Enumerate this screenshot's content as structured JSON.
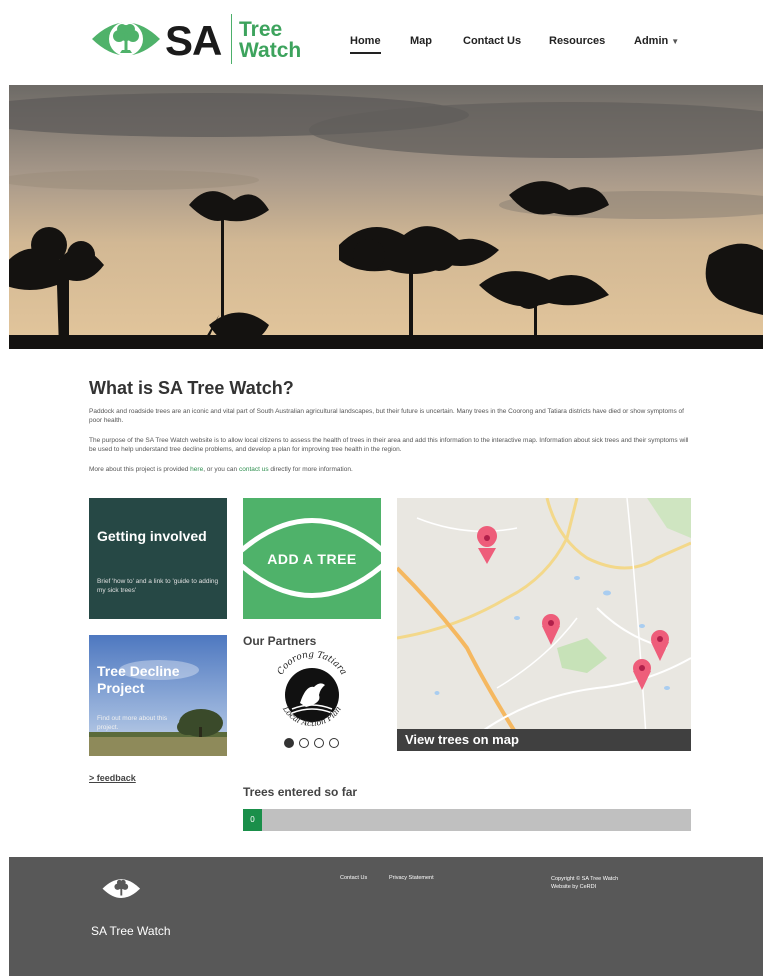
{
  "header": {
    "logo_sa": "SA",
    "logo_tree": "Tree",
    "logo_watch": "Watch"
  },
  "nav": {
    "home": "Home",
    "map": "Map",
    "contact": "Contact Us",
    "resources": "Resources",
    "admin": "Admin"
  },
  "intro": {
    "title": "What is SA Tree Watch?",
    "p1": "Paddock and roadside trees are an iconic and vital part of South Australian agricultural landscapes, but their future is uncertain. Many trees in the Coorong and Tatiara districts have died or show symptoms of poor health.",
    "p2": "The purpose of the SA Tree Watch website is to allow local citizens to assess the health of trees in their area and add this information to the interactive map. Information about sick trees and their symptoms will be used to help understand tree decline problems, and develop a plan for improving tree health in the region.",
    "p3_a": "More about this project is provided ",
    "p3_link1": "here",
    "p3_b": ", or you can ",
    "p3_link2": "contact us",
    "p3_c": " directly for more information."
  },
  "tiles": {
    "getting_title": "Getting involved",
    "getting_desc": "Brief 'how to' and a link to 'guide to adding my sick trees'",
    "add_tree": "ADD A TREE",
    "decline_title": "Tree Decline Project",
    "decline_desc": "Find out more about this project.",
    "partners_title": "Our Partners",
    "partner_top": "Coorong Tatiara",
    "partner_bottom": "Local Action Plan",
    "map_caption": "View trees on map"
  },
  "feedback": "> feedback",
  "trees": {
    "title": "Trees entered so far",
    "count": "0"
  },
  "footer": {
    "name": "SA Tree Watch",
    "contact": "Contact Us",
    "privacy": "Privacy Statement",
    "copyright": "Copyright © SA Tree Watch",
    "credit": "Website by CeRDI"
  },
  "colors": {
    "brand_green": "#4fb26a",
    "dark_teal": "#264845",
    "footer_grey": "#585858",
    "progress_green": "#1a8f4a",
    "marker_pink": "#ee5d7a"
  }
}
